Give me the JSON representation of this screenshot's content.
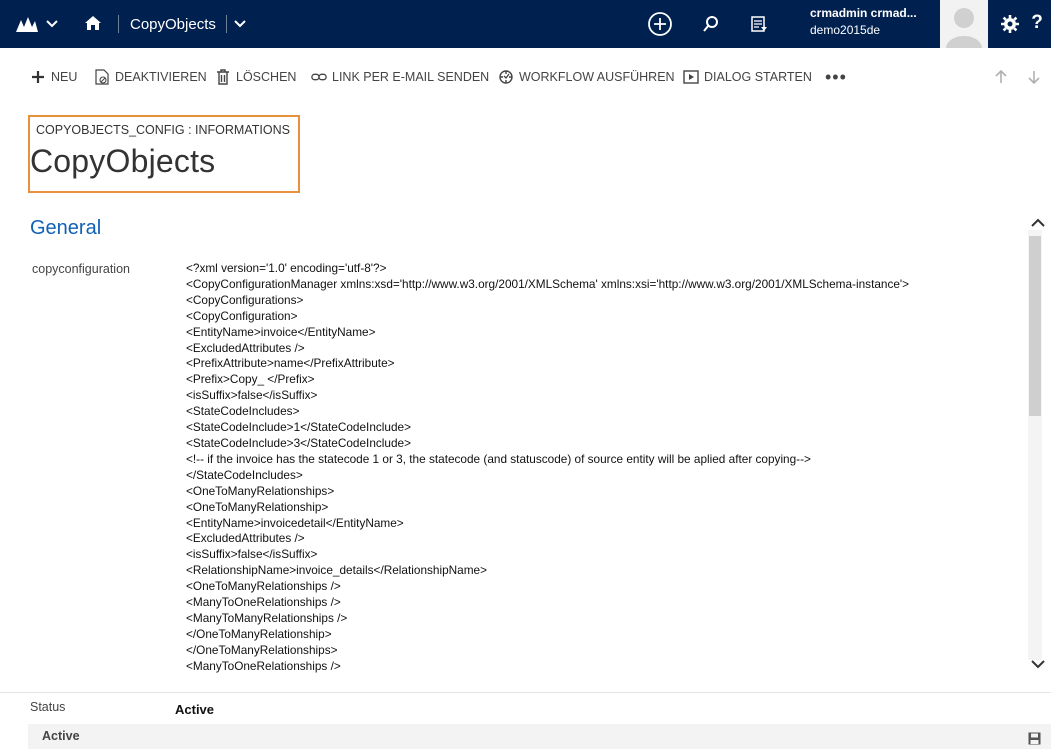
{
  "navbar": {
    "logo_icon": "dynamics-logo-icon",
    "entity_name": "CopyObjects",
    "user_name": "crmadmin crmad...",
    "org_name": "demo2015de",
    "help_label": "?"
  },
  "commands": {
    "new": "NEU",
    "deactivate": "DEAKTIVIEREN",
    "delete": "LÖSCHEN",
    "email_link": "LINK PER E-MAIL SENDEN",
    "run_workflow": "WORKFLOW AUSFÜHREN",
    "start_dialog": "DIALOG STARTEN",
    "more": "•••"
  },
  "header": {
    "entity_form": "COPYOBJECTS_CONFIG : INFORMATIONS",
    "record_name": "CopyObjects"
  },
  "section": {
    "title": "General",
    "field_label": "copyconfiguration",
    "field_lines": [
      "<?xml version='1.0' encoding='utf-8'?>",
      "<CopyConfigurationManager xmlns:xsd='http://www.w3.org/2001/XMLSchema' xmlns:xsi='http://www.w3.org/2001/XMLSchema-instance'>",
      "<CopyConfigurations>",
      "<CopyConfiguration>",
      "<EntityName>invoice</EntityName>",
      "<ExcludedAttributes />",
      "<PrefixAttribute>name</PrefixAttribute>",
      "<Prefix>Copy_ </Prefix>",
      "<isSuffix>false</isSuffix>",
      "<StateCodeIncludes>",
      "<StateCodeInclude>1</StateCodeInclude>",
      "<StateCodeInclude>3</StateCodeInclude>",
      "<!-- if the invoice has the statecode 1 or 3, the statecode (and statuscode) of source entity will be aplied after copying-->",
      "</StateCodeIncludes>",
      "<OneToManyRelationships>",
      "<OneToManyRelationship>",
      "<EntityName>invoicedetail</EntityName>",
      "<ExcludedAttributes />",
      "<isSuffix>false</isSuffix>",
      "<RelationshipName>invoice_details</RelationshipName>",
      "<OneToManyRelationships />",
      "<ManyToOneRelationships />",
      "<ManyToManyRelationships />",
      "</OneToManyRelationship>",
      "</OneToManyRelationships>",
      "<ManyToOneRelationships />"
    ]
  },
  "status": {
    "label": "Status",
    "value": "Active"
  },
  "footer": {
    "state": "Active"
  }
}
